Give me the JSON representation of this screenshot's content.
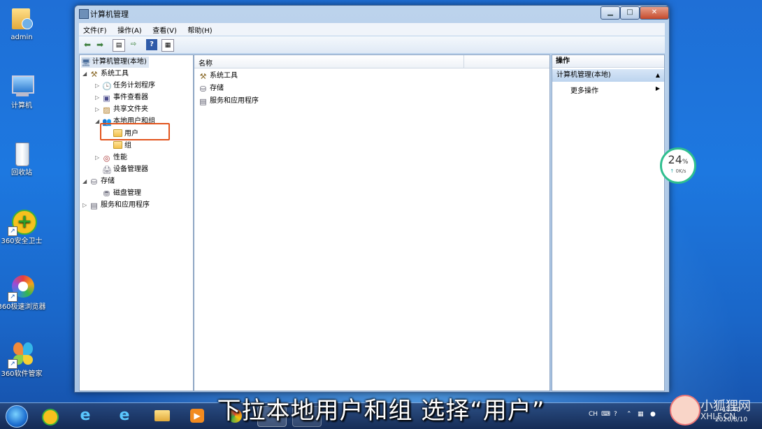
{
  "desktop": {
    "icons": [
      {
        "label": "admin",
        "icon": "user-folder-icon"
      },
      {
        "label": "计算机",
        "icon": "computer-icon"
      },
      {
        "label": "回收站",
        "icon": "recycle-bin-icon"
      },
      {
        "label": "360安全卫士",
        "icon": "360-safe-icon"
      },
      {
        "label": "360极速浏览器",
        "icon": "360-browser-icon"
      },
      {
        "label": "360软件管家",
        "icon": "360-software-icon"
      }
    ]
  },
  "window": {
    "title": "计算机管理",
    "controls": {
      "minimize": "▁",
      "maximize": "□",
      "close": "✕"
    },
    "menu": [
      "文件(F)",
      "操作(A)",
      "查看(V)",
      "帮助(H)"
    ],
    "tree": {
      "root": "计算机管理(本地)",
      "system_tools": "系统工具",
      "task_scheduler": "任务计划程序",
      "event_viewer": "事件查看器",
      "shared_folders": "共享文件夹",
      "local_users_groups": "本地用户和组",
      "users": "用户",
      "groups": "组",
      "performance": "性能",
      "device_manager": "设备管理器",
      "storage": "存储",
      "disk_management": "磁盘管理",
      "services_apps": "服务和应用程序"
    },
    "list": {
      "column_name": "名称",
      "items": [
        "系统工具",
        "存储",
        "服务和应用程序"
      ]
    },
    "actions": {
      "header": "操作",
      "selected": "计算机管理(本地)",
      "more": "更多操作"
    }
  },
  "net_meter": {
    "percent": "24",
    "unit": "%",
    "speed": "0K/s"
  },
  "subtitle": "下拉本地用户和组 选择“用户”",
  "tray": {
    "lang": "CH",
    "time": "14:40",
    "date": "2020/8/10"
  },
  "watermark": {
    "line1": "小狐狸网",
    "line2": "XHLF.CN"
  }
}
